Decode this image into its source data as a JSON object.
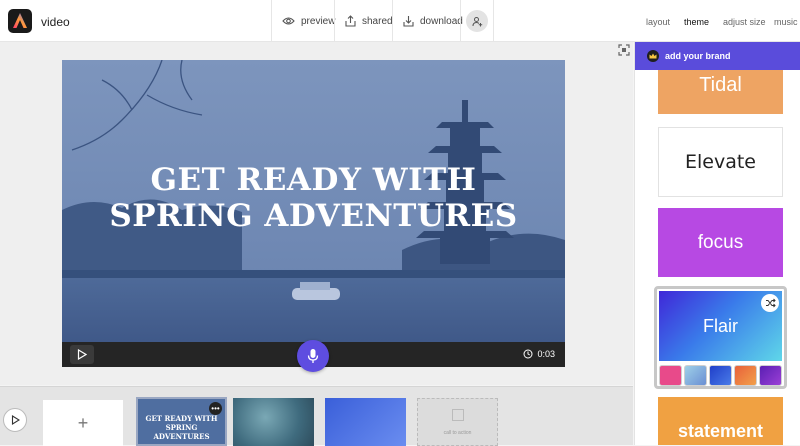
{
  "app": {
    "title": "video"
  },
  "toolbar": {
    "preview_label": "preview",
    "shared_label": "shared",
    "download_label": "download"
  },
  "tabs": [
    {
      "label": "layout"
    },
    {
      "label": "theme",
      "active": true
    },
    {
      "label": "adjust size"
    },
    {
      "label": "music"
    }
  ],
  "video": {
    "headline_line1": "GET READY WITH",
    "headline_line2": "SPRING ADVENTURES",
    "time": "0:03"
  },
  "timeline": {
    "add_label": "+",
    "scene1_text": "GET READY WITH SPRING ADVENTURES",
    "scene1_more": "•••",
    "scene4_label": "call to action"
  },
  "panel": {
    "brand_label": "add your brand",
    "themes": [
      {
        "name": "Tidal",
        "color": "#eea463"
      },
      {
        "name": "Elevate",
        "color": "#ffffff"
      },
      {
        "name": "focus",
        "color": "#b749e3"
      },
      {
        "name": "Flair",
        "color": "#3f27d8",
        "selected": true
      },
      {
        "name": "statement",
        "color": "#f0a142"
      }
    ],
    "flair_swatches": [
      "#e84a8a",
      "#7fb3d8",
      "#2e59d9",
      "#e8613a",
      "#7a2fc9"
    ]
  },
  "colors": {
    "accent": "#5a4cdb",
    "mic": "#5e4de0"
  }
}
